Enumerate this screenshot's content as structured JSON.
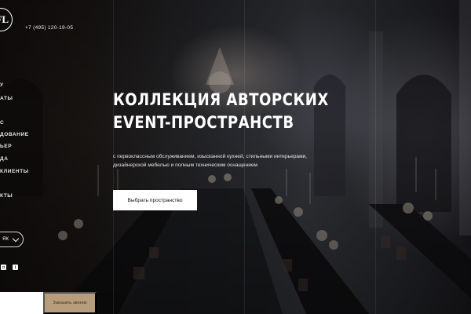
{
  "header": {
    "logo_text": "FL",
    "phone": "+7 (495) 120-19-05"
  },
  "nav": {
    "items": [
      {
        "label": "У"
      },
      {
        "label": "АТЫ"
      },
      {
        "label": "С"
      },
      {
        "label": "ДОВАНИЕ"
      },
      {
        "label": "ЬЕР"
      },
      {
        "label": "ДА"
      },
      {
        "label": "КЛИЕНТЫ"
      },
      {
        "label": "КТЫ"
      }
    ]
  },
  "language": {
    "selected": "ЯК",
    "icon": "chevron-down-icon"
  },
  "social": [
    {
      "icon": "instagram-icon",
      "glyph": "◘"
    },
    {
      "icon": "info-icon",
      "glyph": "i"
    }
  ],
  "hero": {
    "title_line1": "КОЛЛЕКЦИЯ АВТОРСКИХ",
    "title_line2": "EVENT-ПРОСТРАНСТВ",
    "subtitle": "с первоклассным обслуживанием, изысканной кухней, стильными интерьерами, дизайнерской мебелью и полным техническим оснащением",
    "cta_label": "Выбрать пространство"
  },
  "footer": {
    "callback_label": "Заказать звонок"
  },
  "colors": {
    "accent": "#b79d7b",
    "background": "#0c0d10",
    "text": "#ffffff"
  }
}
